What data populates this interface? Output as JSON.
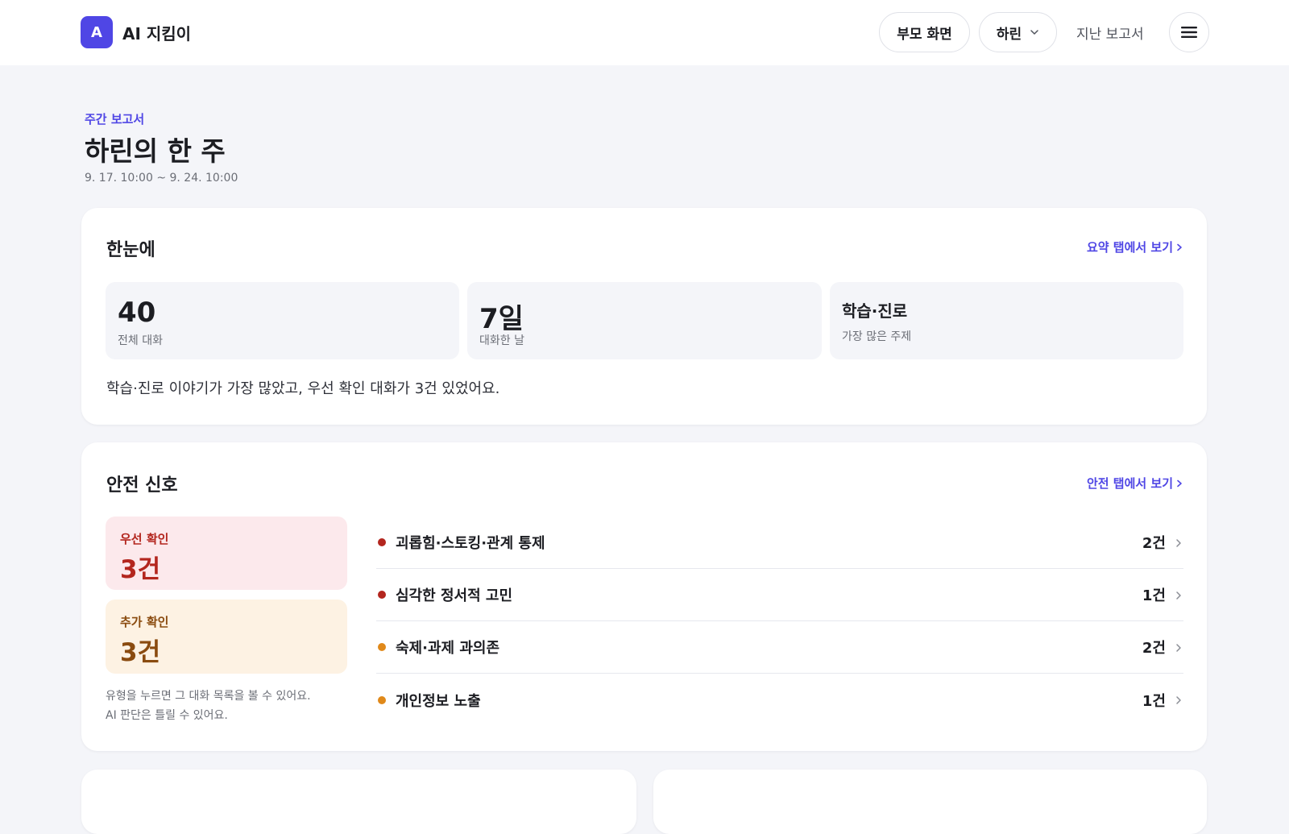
{
  "app": {
    "logo_letter": "A",
    "name": "AI 지킴이"
  },
  "topbar": {
    "parent_view_label": "부모 화면",
    "child_selector_label": "하린",
    "past_reports_label": "지난 보고서",
    "icons": {
      "chevron": "chevron-down-icon",
      "menu": "hamburger-menu-icon"
    }
  },
  "header": {
    "eyebrow": "주간 보고서",
    "title": "하린의 한 주",
    "period": "9. 17. 10:00 ~ 9. 24. 10:00"
  },
  "summary": {
    "title": "한눈에",
    "link": "요약 탭에서 보기",
    "stats": [
      {
        "value": "40",
        "label": "전체 대화"
      },
      {
        "value": "7일",
        "label": "대화한 날"
      },
      {
        "value": "학습·진로",
        "label": "가장 많은 주제"
      }
    ],
    "text": "학습·진로 이야기가 가장 많았고, 우선 확인 대화가 3건 있었어요."
  },
  "safety": {
    "title": "안전 신호",
    "link": "안전 탭에서 보기",
    "levels": [
      {
        "label": "우선 확인",
        "value": "3건",
        "color": "#b3261e",
        "bg": "#fce9ec"
      },
      {
        "label": "추가 확인",
        "value": "3건",
        "color": "#8a4b0f",
        "bg": "#fdf2e3"
      }
    ],
    "helper_lines": [
      "유형을 누르면 그 대화 목록을 볼 수 있어요.",
      "AI 판단은 틀릴 수 있어요."
    ],
    "signals": [
      {
        "label": "괴롭힘·스토킹·관계 통제",
        "count": "2건",
        "color": "#b3261e"
      },
      {
        "label": "심각한 정서적 고민",
        "count": "1건",
        "color": "#b3261e"
      },
      {
        "label": "숙제·과제 과의존",
        "count": "2건",
        "color": "#e0891a"
      },
      {
        "label": "개인정보 노출",
        "count": "1건",
        "color": "#e0891a"
      }
    ]
  },
  "colors": {
    "accent": "#4f46e5",
    "page_bg": "#f4f5f9",
    "card_bg": "#ffffff"
  }
}
